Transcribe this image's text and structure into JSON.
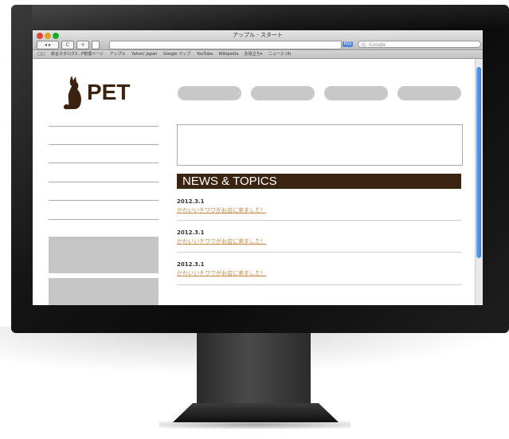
{
  "window": {
    "title": "アップル - スタート"
  },
  "toolbar": {
    "back_label": "◂ ▸",
    "reload_label": "C",
    "add_label": "+",
    "rss_label": "RSS",
    "search_placeholder": "Q- Google"
  },
  "bookmarks": {
    "items": [
      "総合カタログ2...P管理ページ",
      "アップル",
      "Yahoo! Japan",
      "Google マップ",
      "YouTube",
      "Wikipedia",
      "お役立ち▾",
      "ニュース (4)"
    ]
  },
  "site": {
    "logo_text": "PET",
    "nav_pills": [
      "",
      "",
      "",
      ""
    ],
    "news_title": "NEWS & TOPICS",
    "news": [
      {
        "date": "2012.3.1",
        "text": "かわいいチワワがお店に来ました！"
      },
      {
        "date": "2012.3.1",
        "text": "かわいいチワワがお店に来ました！"
      },
      {
        "date": "2012.3.1",
        "text": "かわいいチワワがお店に来ました！"
      }
    ]
  },
  "colors": {
    "brand_brown": "#3a230f",
    "link_tan": "#c08a46",
    "placeholder_gray": "#c8c8c8",
    "scroll_blue": "#3b7fe0"
  }
}
